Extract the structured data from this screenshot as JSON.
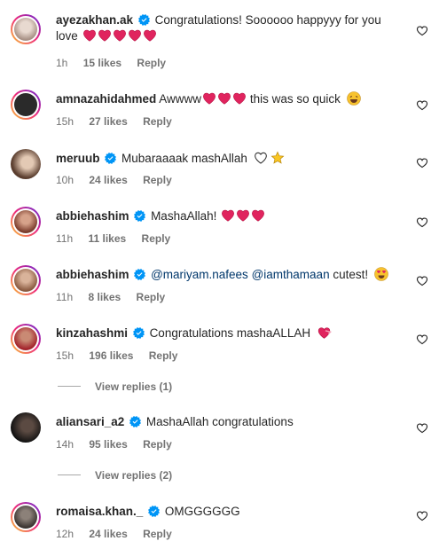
{
  "comments": [
    {
      "user": "ayezakhan.ak",
      "text": "Congratulations! Soooooo happyyy for you love",
      "emoji_hearts": 5,
      "time": "1h",
      "likes": "15 likes",
      "reply": "Reply"
    },
    {
      "user": "amnazahidahmed",
      "text_before": "Awwww",
      "text_after": "this was so quick",
      "emoji_hearts": 3,
      "time": "15h",
      "likes": "27 likes",
      "reply": "Reply"
    },
    {
      "user": "meruub",
      "text": "Mubaraaaak mashAllah",
      "time": "10h",
      "likes": "24 likes",
      "reply": "Reply"
    },
    {
      "user": "abbiehashim",
      "text": "MashaAllah!",
      "emoji_hearts": 3,
      "time": "11h",
      "likes": "11 likes",
      "reply": "Reply"
    },
    {
      "user": "abbiehashim",
      "mention1": "@mariyam.nafees",
      "mention2": "@iamthamaan",
      "text": "cutest!",
      "time": "11h",
      "likes": "8 likes",
      "reply": "Reply"
    },
    {
      "user": "kinzahashmi",
      "text": "Congratulations mashaALLAH",
      "time": "15h",
      "likes": "196 likes",
      "reply": "Reply",
      "view_replies": "View replies (1)"
    },
    {
      "user": "aliansari_a2",
      "text": "MashaAllah congratulations",
      "time": "14h",
      "likes": "95 likes",
      "reply": "Reply",
      "view_replies": "View replies (2)"
    },
    {
      "user": "romaisa.khan._",
      "text": "OMGGGGGG",
      "time": "12h",
      "likes": "24 likes",
      "reply": "Reply"
    }
  ],
  "colors": {
    "heart": "#e0245e",
    "verified": "#0095f6",
    "meta": "#737373"
  },
  "icons": {
    "like": "heart-outline-icon",
    "verified": "verified-badge-icon"
  }
}
